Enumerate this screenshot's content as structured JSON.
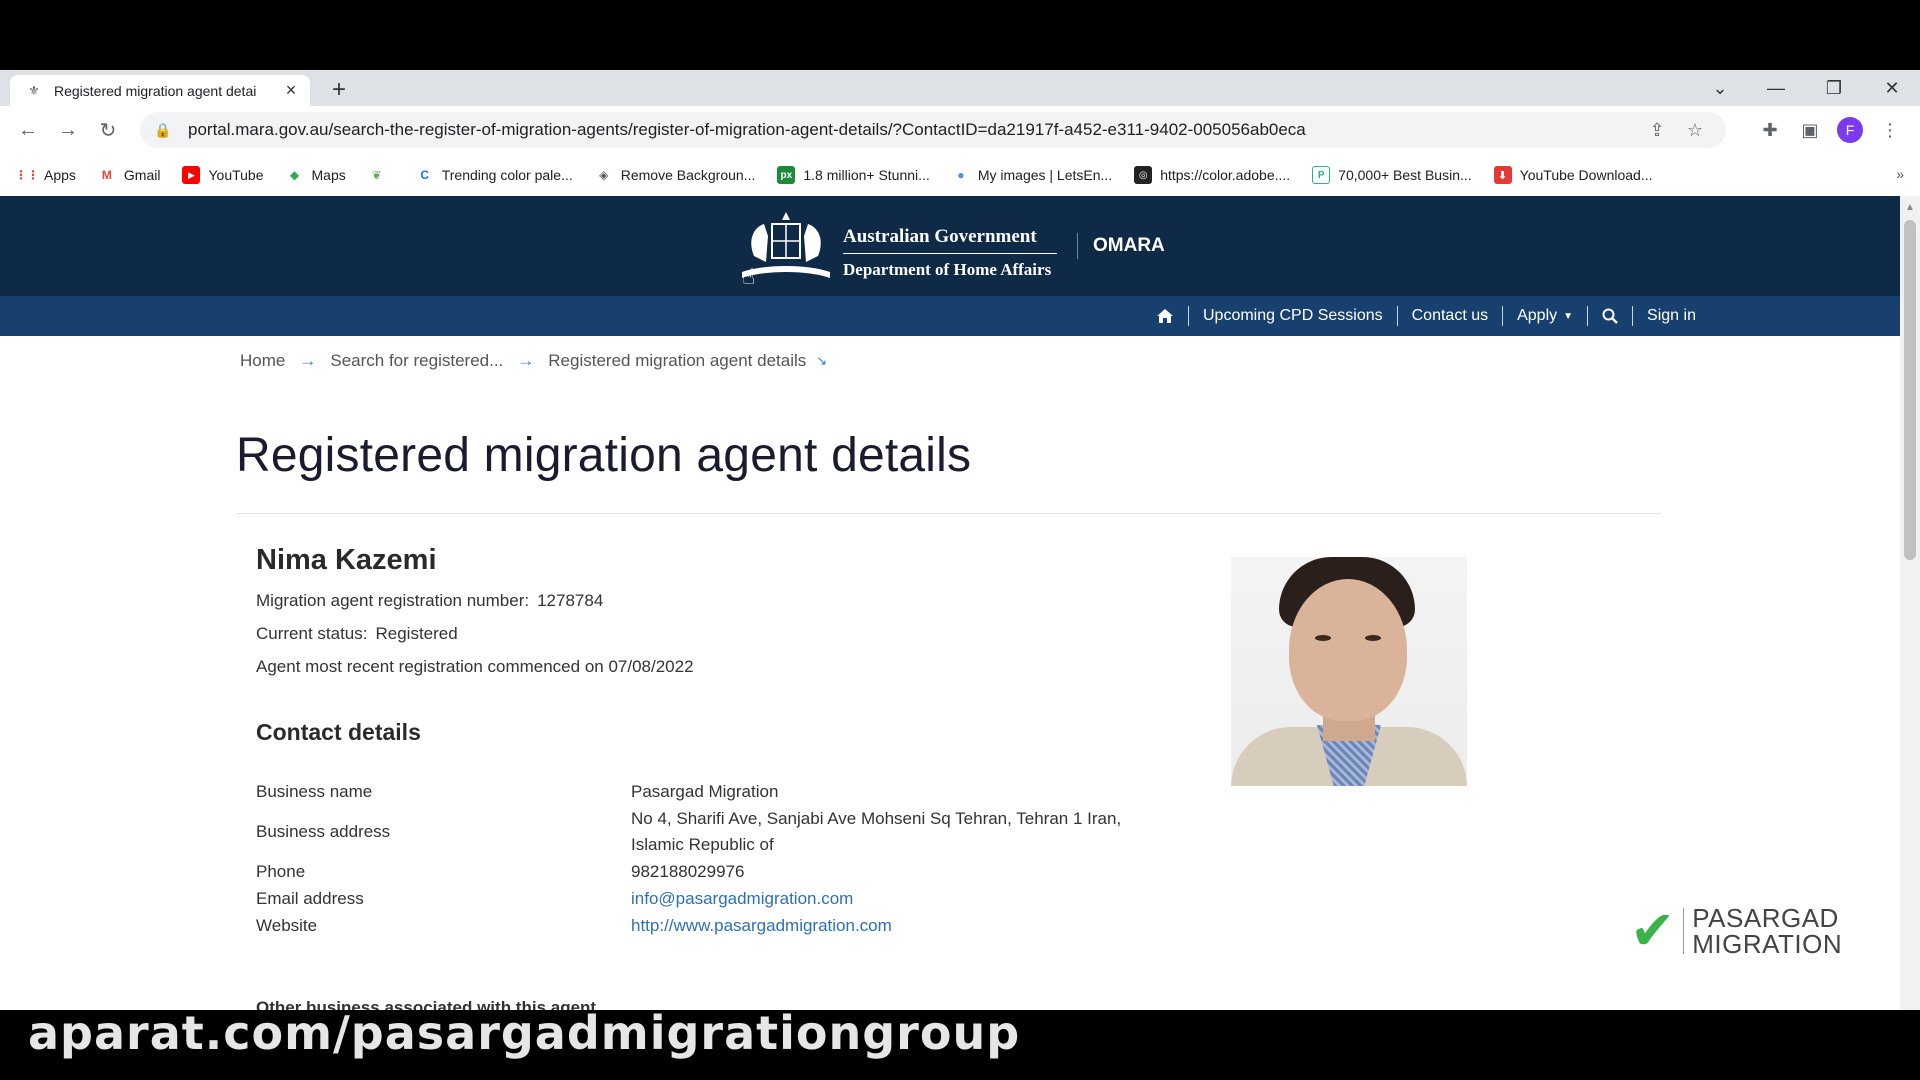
{
  "browser": {
    "tab_title": "Registered migration agent detai",
    "url": "portal.mara.gov.au/search-the-register-of-migration-agents/register-of-migration-agent-details/?ContactID=da21917f-a452-e311-9402-005056ab0eca",
    "profile_initial": "F",
    "bookmarks": [
      {
        "label": "Apps",
        "icon": "apps-grid-icon",
        "color": "#ea4335"
      },
      {
        "label": "Gmail",
        "icon": "gmail-icon",
        "color": "#ea4335"
      },
      {
        "label": "YouTube",
        "icon": "youtube-icon",
        "color": "#ff0000"
      },
      {
        "label": "Maps",
        "icon": "maps-icon",
        "color": "#34a853"
      },
      {
        "label": "",
        "icon": "leaf-icon",
        "color": "#6aa84f"
      },
      {
        "label": "Trending color pale...",
        "icon": "c-logo-icon",
        "color": "#1a73e8"
      },
      {
        "label": "Remove Backgroun...",
        "icon": "layers-icon",
        "color": "#555555"
      },
      {
        "label": "1.8 million+ Stunni...",
        "icon": "px-icon",
        "color": "#1e8a3a"
      },
      {
        "label": "My images | LetsEn...",
        "icon": "sphere-icon",
        "color": "#4a8cf0"
      },
      {
        "label": "https://color.adobe....",
        "icon": "adobe-color-icon",
        "color": "#222222"
      },
      {
        "label": "70,000+ Best Busin...",
        "icon": "p-logo-icon",
        "color": "#2bb38a"
      },
      {
        "label": "YouTube Download...",
        "icon": "download-icon",
        "color": "#e53935"
      }
    ]
  },
  "header": {
    "gov_line1": "Australian Government",
    "gov_line2": "Department of Home Affairs",
    "brand": "OMARA",
    "bg_color": "#0f2a47",
    "nav_bg_color": "#17406e"
  },
  "nav": {
    "items": [
      "Upcoming CPD Sessions",
      "Contact us",
      "Apply",
      "Sign in"
    ]
  },
  "breadcrumb": [
    "Home",
    "Search for registered...",
    "Registered migration agent details"
  ],
  "page": {
    "title": "Registered migration agent details"
  },
  "agent": {
    "name": "Nima Kazemi",
    "reg_label": "Migration agent registration number:",
    "reg_number": "1278784",
    "status_label": "Current status:",
    "status": "Registered",
    "commenced_text": "Agent most recent registration commenced on 07/08/2022"
  },
  "contact": {
    "heading": "Contact details",
    "business_name_label": "Business name",
    "business_name": "Pasargad Migration",
    "business_address_label": "Business address",
    "business_address_line1": "No 4, Sharifi Ave, Sanjabi Ave Mohseni Sq Tehran, Tehran 1 Iran,",
    "business_address_line2": "Islamic Republic of",
    "phone_label": "Phone",
    "phone": "982188029976",
    "email_label": "Email address",
    "email": "info@pasargadmigration.com",
    "website_label": "Website",
    "website": "http://www.pasargadmigration.com"
  },
  "other_business_heading": "Other business associated with this agent",
  "logo": {
    "line1": "PASARGAD",
    "line2": "MIGRATION"
  },
  "watermark": "aparat.com/pasargadmigrationgroup"
}
